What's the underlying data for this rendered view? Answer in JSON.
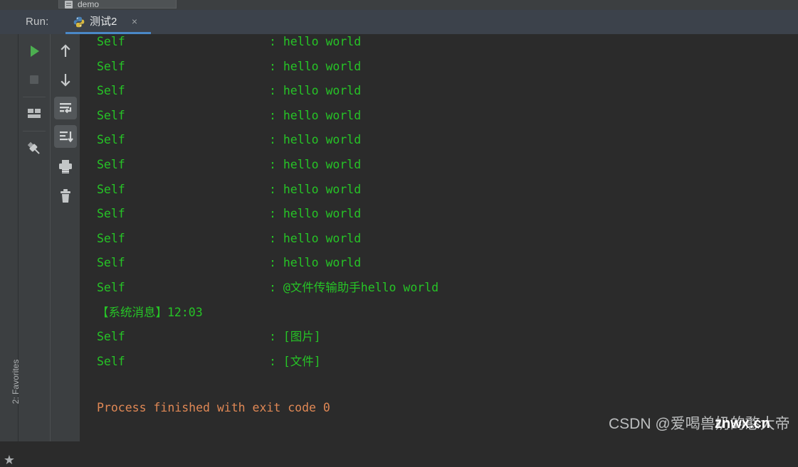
{
  "editor_strip": {
    "tab_label": "demo",
    "tab_icon": "file-icon"
  },
  "run_panel": {
    "label": "Run:",
    "tab": {
      "title": "测试2",
      "icon": "python-icon",
      "close_label": "×"
    }
  },
  "left_stripe": {
    "favorites_label": "2: Favorites",
    "favorites_star": "★"
  },
  "toolbar": {
    "buttons": [
      {
        "name": "rerun-button",
        "icon": "play-icon"
      },
      {
        "name": "stop-button",
        "icon": "stop-icon"
      },
      {
        "name": "restore-layout-button",
        "icon": "layout-icon"
      },
      {
        "name": "pin-tab-button",
        "icon": "pin-icon"
      },
      {
        "name": "up-stack-trace-button",
        "icon": "arrow-up-icon"
      },
      {
        "name": "down-stack-trace-button",
        "icon": "arrow-down-icon"
      },
      {
        "name": "soft-wrap-button",
        "icon": "soft-wrap-icon"
      },
      {
        "name": "scroll-to-end-button",
        "icon": "scroll-to-end-icon"
      },
      {
        "name": "print-button",
        "icon": "printer-icon"
      },
      {
        "name": "clear-all-button",
        "icon": "trash-icon"
      }
    ]
  },
  "console": {
    "lines": [
      {
        "speaker": "Self",
        "sep": ": ",
        "message": "hello world",
        "kind": "chat"
      },
      {
        "speaker": "Self",
        "sep": ": ",
        "message": "hello world",
        "kind": "chat"
      },
      {
        "speaker": "Self",
        "sep": ": ",
        "message": "hello world",
        "kind": "chat"
      },
      {
        "speaker": "Self",
        "sep": ": ",
        "message": "hello world",
        "kind": "chat"
      },
      {
        "speaker": "Self",
        "sep": ": ",
        "message": "hello world",
        "kind": "chat"
      },
      {
        "speaker": "Self",
        "sep": ": ",
        "message": "hello world",
        "kind": "chat"
      },
      {
        "speaker": "Self",
        "sep": ": ",
        "message": "hello world",
        "kind": "chat"
      },
      {
        "speaker": "Self",
        "sep": ": ",
        "message": "hello world",
        "kind": "chat"
      },
      {
        "speaker": "Self",
        "sep": ": ",
        "message": "hello world",
        "kind": "chat"
      },
      {
        "speaker": "Self",
        "sep": ": ",
        "message": "hello world",
        "kind": "chat"
      },
      {
        "speaker": "Self",
        "sep": ": ",
        "message": "@文件传输助手hello world",
        "kind": "chat"
      },
      {
        "speaker": "",
        "sep": "",
        "message": "【系统消息】12:03",
        "kind": "system"
      },
      {
        "speaker": "Self",
        "sep": ": ",
        "message": "[图片]",
        "kind": "chat"
      },
      {
        "speaker": "Self",
        "sep": ": ",
        "message": "[文件]",
        "kind": "chat"
      }
    ],
    "exit_line": "Process finished with exit code 0",
    "text_color": "#26c426",
    "exit_color": "#e08855",
    "background": "#2b2b2b"
  },
  "watermark": {
    "csdn_text": "CSDN @爱喝兽奶的憨大帝",
    "site_text": "znwx.cn"
  }
}
